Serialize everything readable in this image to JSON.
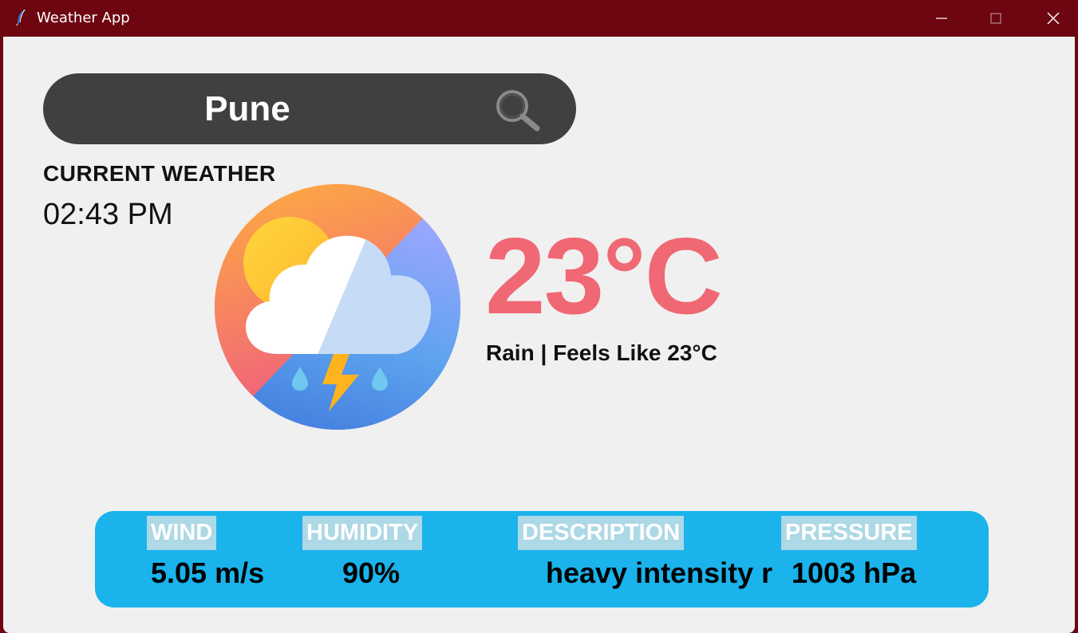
{
  "window": {
    "title": "Weather App",
    "app_icon": "feather-icon",
    "controls": [
      "minimize-icon",
      "maximize-icon",
      "close-icon"
    ]
  },
  "search": {
    "value": "Pune",
    "icon": "search-icon"
  },
  "current": {
    "label": "CURRENT WEATHER",
    "time": "02:43 PM"
  },
  "weather_icon": "thunderstorm-rain-icon",
  "temperature": "23°C",
  "condition": "Rain | Feels Like 23°C",
  "stats": {
    "wind_label": "WIND",
    "wind_value": "5.05 m/s",
    "humidity_label": "HUMIDITY",
    "humidity_value": "90%",
    "description_label": "DESCRIPTION",
    "description_value": "heavy intensity r",
    "pressure_label": "PRESSURE",
    "pressure_value": "1003 hPa"
  },
  "colors": {
    "titlebar": "#6d0610",
    "background": "#f0f0f0",
    "search_bar": "#404040",
    "temperature": "#ef6874",
    "stats_panel": "#1ab3ec",
    "stat_label_bg": "#add8e6"
  }
}
